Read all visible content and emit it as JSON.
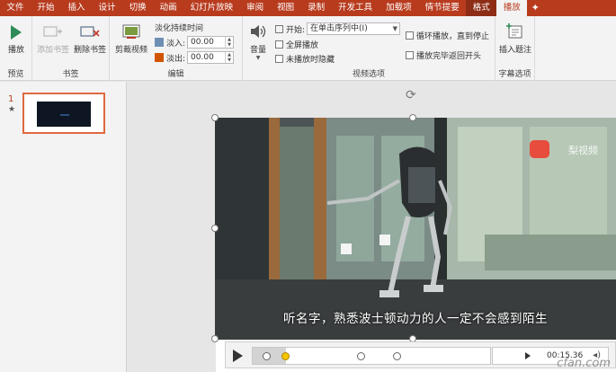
{
  "tabs": [
    {
      "label": "文件"
    },
    {
      "label": "开始"
    },
    {
      "label": "插入"
    },
    {
      "label": "设计"
    },
    {
      "label": "切换"
    },
    {
      "label": "动画"
    },
    {
      "label": "幻灯片放映"
    },
    {
      "label": "审阅"
    },
    {
      "label": "视图"
    },
    {
      "label": "录制"
    },
    {
      "label": "开发工具"
    },
    {
      "label": "加载项"
    },
    {
      "label": "情节提要"
    },
    {
      "label": "格式"
    },
    {
      "label": "播放"
    }
  ],
  "ribbon": {
    "preview": {
      "play_label": "播放",
      "group_label": "预览"
    },
    "bookmarks": {
      "add_label": "添加书签",
      "remove_label": "删除书签",
      "group_label": "书签"
    },
    "editing": {
      "trim_label": "剪裁视频",
      "fade_title": "淡化持续时间",
      "fade_in_label": "淡入:",
      "fade_in_value": "00.00",
      "fade_out_label": "淡出:",
      "fade_out_value": "00.00",
      "group_label": "编辑"
    },
    "video_options": {
      "volume_label": "音量",
      "start_label": "开始:",
      "start_value": "在单击序列中(I)",
      "fullscreen_label": "全屏播放",
      "hide_label": "未播放时隐藏",
      "loop_label": "循环播放，直到停止",
      "rewind_label": "播放完毕返回开头",
      "group_label": "视频选项"
    },
    "captions": {
      "insert_label": "插入题注",
      "group_label": "字幕选项"
    }
  },
  "slides_pane": {
    "number": "1",
    "mark": "★"
  },
  "video": {
    "subtitle": "听名字，熟悉波士顿动力的人一定不会感到陌生",
    "logo_text": "梨视频"
  },
  "player": {
    "time": "00:15.36",
    "progress": 0.14,
    "bookmarks": [
      0.06,
      0.14,
      0.46,
      0.61
    ]
  },
  "watermark": "cfan.com"
}
